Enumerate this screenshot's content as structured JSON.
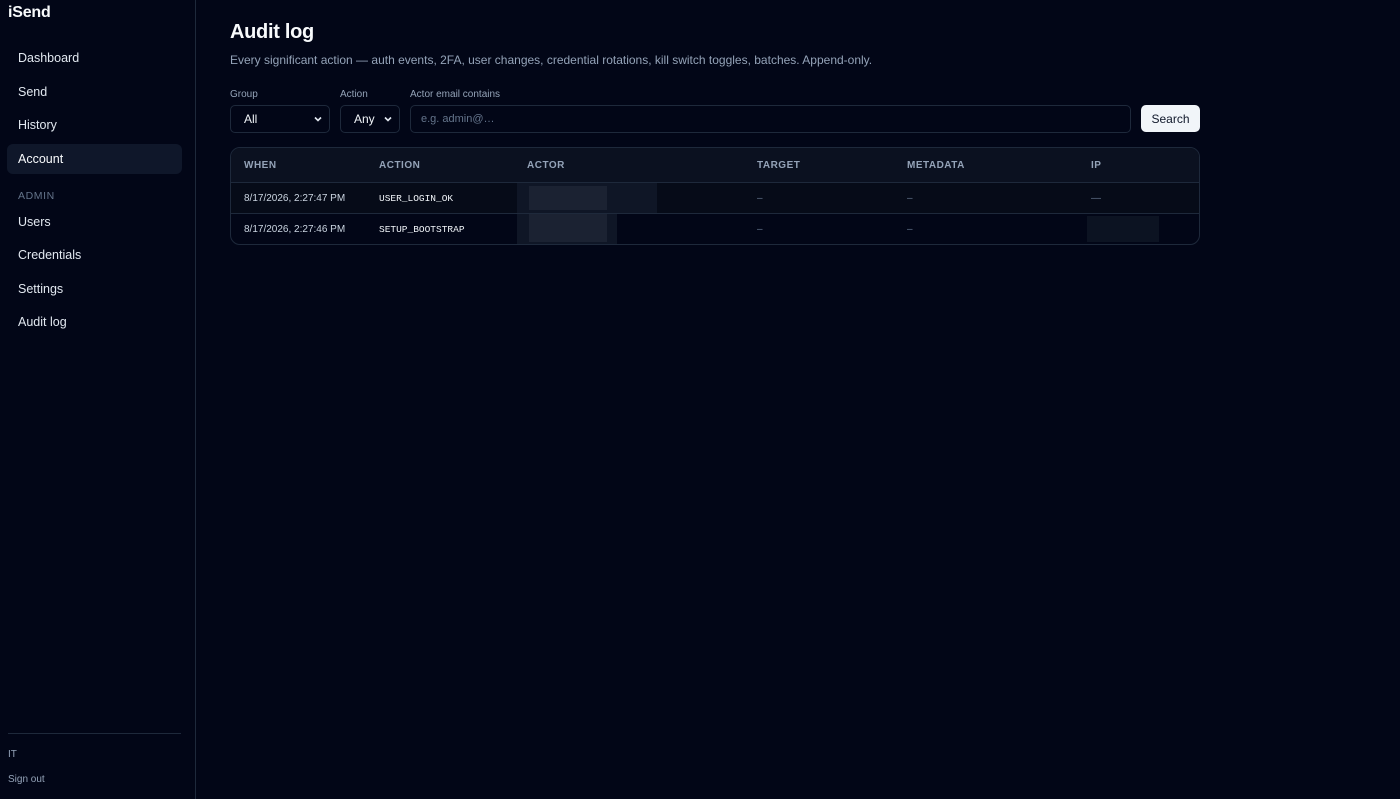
{
  "brand": "iSend",
  "sidebar": {
    "items": [
      {
        "label": "Dashboard",
        "active": false
      },
      {
        "label": "Send",
        "active": false
      },
      {
        "label": "History",
        "active": false
      },
      {
        "label": "Account",
        "active": true
      }
    ],
    "admin_section": "ADMIN",
    "admin_items": [
      {
        "label": "Users"
      },
      {
        "label": "Credentials"
      },
      {
        "label": "Settings"
      },
      {
        "label": "Audit log"
      }
    ],
    "footer": {
      "org": "IT",
      "sign_out": "Sign out"
    }
  },
  "page": {
    "title": "Audit log",
    "subtitle": "Every significant action — auth events, 2FA, user changes, credential rotations, kill switch toggles, batches. Append-only."
  },
  "filters": {
    "group_label": "Group",
    "group_value": "All",
    "action_label": "Action",
    "action_value": "Any",
    "actor_label": "Actor email contains",
    "actor_placeholder": "e.g. admin@…",
    "search_label": "Search"
  },
  "table": {
    "columns": [
      "WHEN",
      "ACTION",
      "ACTOR",
      "TARGET",
      "METADATA",
      "IP"
    ],
    "rows": [
      {
        "when": "8/17/2026, 2:27:47 PM",
        "action": "USER_LOGIN_OK",
        "target": "–",
        "metadata": "–",
        "ip": "—"
      },
      {
        "when": "8/17/2026, 2:27:46 PM",
        "action": "SETUP_BOOTSTRAP",
        "target": "–",
        "metadata": "–",
        "ip": ""
      }
    ]
  }
}
